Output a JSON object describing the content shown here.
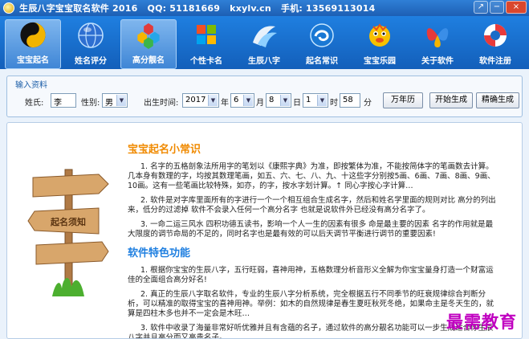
{
  "titlebar": {
    "title": "生辰八字宝宝取名软件 2016   QQ: 51181669   kxylv.cn   手机: 13569113014",
    "buttons": [
      "↗",
      "−",
      "×"
    ]
  },
  "toolbar": {
    "items": [
      {
        "label": "宝宝起名",
        "icon": "yin-yang-icon"
      },
      {
        "label": "姓名评分",
        "icon": "globe-icon"
      },
      {
        "label": "高分靓名",
        "icon": "hexagon-flower-icon"
      },
      {
        "label": "个性卡名",
        "icon": "window-logo-icon"
      },
      {
        "label": "生辰八字",
        "icon": "wave-swoosh-icon"
      },
      {
        "label": "起名常识",
        "icon": "swirl-icon"
      },
      {
        "label": "宝宝乐园",
        "icon": "bird-mascot-icon"
      },
      {
        "label": "关于软件",
        "icon": "butterfly-icon"
      },
      {
        "label": "软件注册",
        "icon": "lifebuoy-icon"
      }
    ]
  },
  "input_panel": {
    "title": "输入资料",
    "surname_label": "姓氏:",
    "surname_value": "李",
    "gender_label": "性别:",
    "gender_value": "男",
    "birth_label": "出生时间:",
    "year_value": "2017",
    "year_unit": "年",
    "month_value": "6",
    "month_unit": "月",
    "day_value": "8",
    "day_unit": "日",
    "hour_value": "1",
    "hour_unit": "时",
    "minute_value": "58",
    "minute_unit": "分",
    "calendar_button": "万年历",
    "generate_button": "开始生成",
    "precise_button": "精确生成"
  },
  "content": {
    "sign_text": "起名须知",
    "heading1": "宝宝起名小常识",
    "para1": "1. 名字的五格剖象法所用字的笔划以《康熙字典》为准，即按繁体为准，不能按简体字的笔画数去计算。几本身有数理的字，均按其数理笔画，如五、六、七、八、九、十这些字分别按5画、6画、7画、8画、9画、10画。这有一些笔画比较特殊，如亦，的字，按水字划计算。↑ 同心字按心字计算…",
    "para2": "2. 软件是对字库里面所有的字进行一个一个相互组合生成名字，然后和姓名学里面的规则对比 高分的列出来，低分的过滤掉 软件不会录入任何一个高分名字 也就是说软件外已经没有高分名字了。",
    "para3": "3. 一命二运三风水 四积功德五读书，影响一个人一生的因素有很多 命是最主要的因素 名字的作用就是最大限度的调节命局的不足的，同时名字也是最有效的可以后天调节平衡进行调节的重要因素!",
    "heading2": "软件特色功能",
    "para4": "1. 根据你宝宝的生辰八字，五行旺弱，喜神用神，五格数理分析音形义全解为你宝宝量身打造一个财富运佳的全面组合高分好名!",
    "para5": "2. 真正的生辰八字取名软件，专业的生辰八字分析系统，完全根据五行不同季节的旺衰规律综合判断分析，可以精准的取得宝宝的喜神用神。举例：如木的自然规律是春生夏旺秋死冬绝，如果命主是冬天生的，就算是四柱木多也并不一定会是木旺…",
    "para6": "3. 软件中收录了海量非常好听优雅并且有含蕴的名子，通过软件的高分靓名功能可以一步生成适合你生辰八字并且高分而又高贵名子。"
  },
  "watermark": "最需教育",
  "colors": {
    "toolbar_blue": "#1f7fe0",
    "heading_orange": "#f08a00",
    "heading_blue": "#1f7fe0",
    "watermark_magenta": "#c000c0"
  }
}
